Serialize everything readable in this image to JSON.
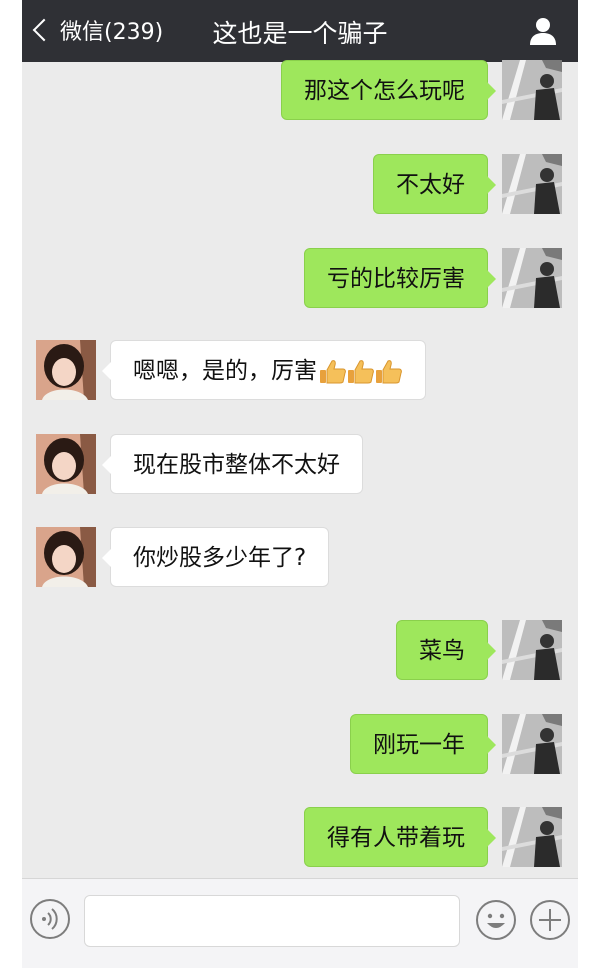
{
  "header": {
    "back_label": "微信(239)",
    "title": "这也是一个骗子",
    "profile_icon": "person-icon"
  },
  "colors": {
    "topbar": "#2f3035",
    "chat_background": "#ebebeb",
    "my_bubble": "#9ee75c",
    "their_bubble": "#ffffff"
  },
  "messages": [
    {
      "sender": "me",
      "text": "那这个怎么玩呢"
    },
    {
      "sender": "me",
      "text": "不太好"
    },
    {
      "sender": "me",
      "text": "亏的比较厉害"
    },
    {
      "sender": "them",
      "text": "嗯嗯，是的，厉害",
      "emoji": [
        "thumbs-up",
        "thumbs-up",
        "thumbs-up"
      ]
    },
    {
      "sender": "them",
      "text": "现在股市整体不太好"
    },
    {
      "sender": "them",
      "text": "你炒股多少年了?"
    },
    {
      "sender": "me",
      "text": "菜鸟"
    },
    {
      "sender": "me",
      "text": "刚玩一年"
    },
    {
      "sender": "me",
      "text": "得有人带着玩"
    }
  ],
  "input_bar": {
    "value": "",
    "voice_icon": "voice-icon",
    "emoji_icon": "emoji-icon",
    "plus_icon": "plus-icon"
  }
}
